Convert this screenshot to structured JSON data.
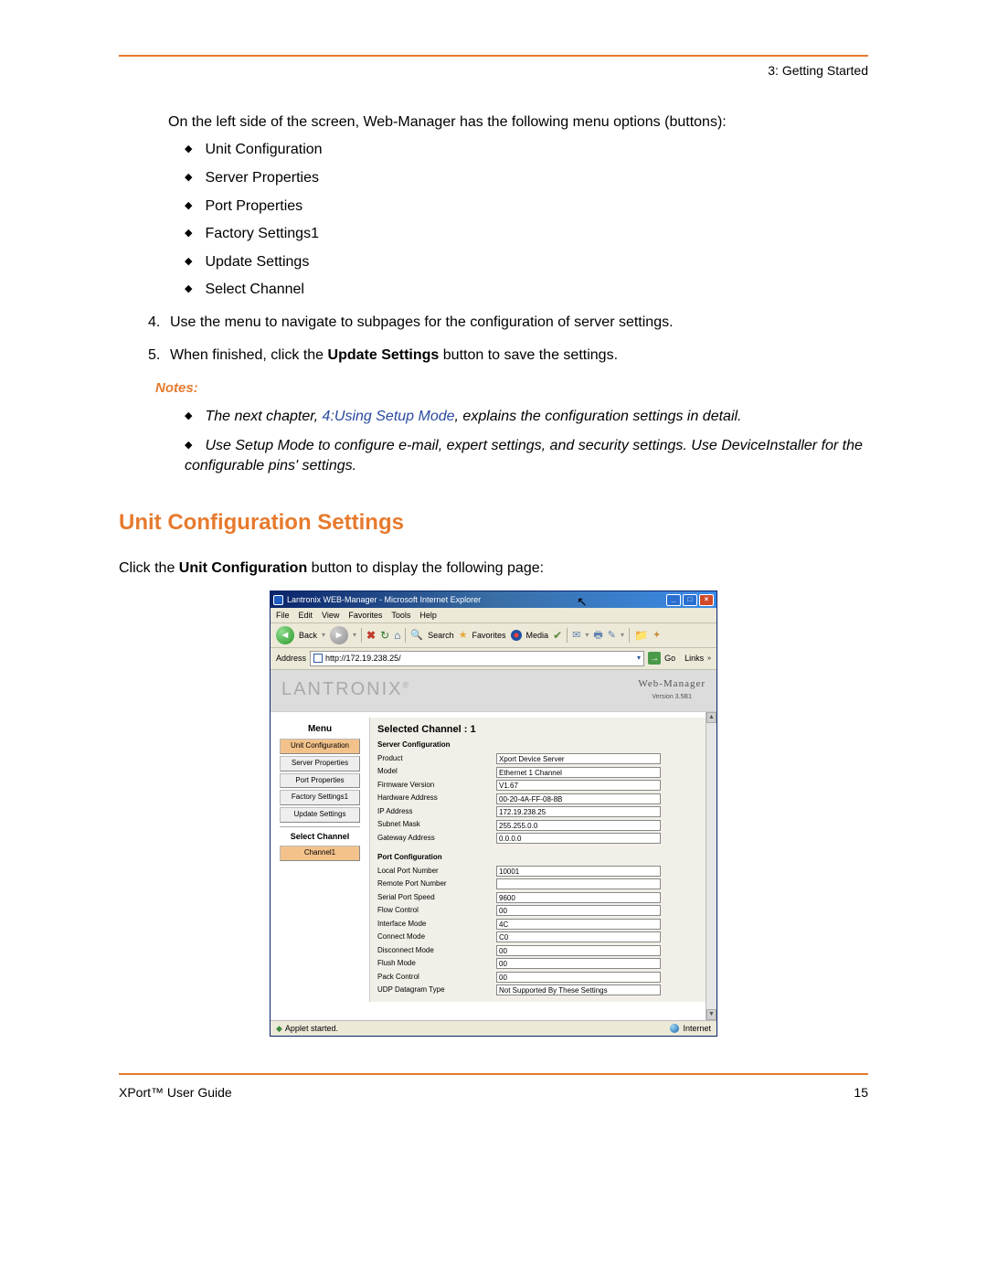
{
  "header": {
    "chapter": "3: Getting Started"
  },
  "body": {
    "intro": "On the left side of the screen, Web-Manager has the following menu options (buttons):",
    "menu_bullets": [
      "Unit Configuration",
      "Server Properties",
      "Port Properties",
      "Factory Settings1",
      "Update Settings",
      "Select Channel"
    ],
    "step4_num": "4.",
    "step4": "Use the menu to navigate to subpages for the configuration of server settings.",
    "step5_num": "5.",
    "step5_pre": "When finished, click the ",
    "step5_bold": "Update Settings",
    "step5_post": " button to save the settings.",
    "notes_label": "Notes:",
    "note1_pre": "The next chapter, ",
    "note1_link": "4:Using Setup Mode",
    "note1_post": ", explains the configuration settings in detail.",
    "note2": "Use Setup Mode to configure e-mail, expert settings, and security settings. Use DeviceInstaller for the configurable pins' settings.",
    "h2": "Unit Configuration Settings",
    "click_pre": "Click the ",
    "click_bold": "Unit Configuration",
    "click_post": " button to display the following page:"
  },
  "ie": {
    "title": "Lantronix WEB-Manager - Microsoft Internet Explorer",
    "menus": [
      "File",
      "Edit",
      "View",
      "Favorites",
      "Tools",
      "Help"
    ],
    "back_label": "Back",
    "search": "Search",
    "favorites": "Favorites",
    "media": "Media",
    "address_label": "Address",
    "address_url": "http://172.19.238.25/",
    "go_label": "Go",
    "links_label": "Links",
    "brand": "LANTRONIX",
    "brand_reg": "®",
    "wm_title": "Web-Manager",
    "wm_version": "Version 3.5B1",
    "menu_title": "Menu",
    "menu_items": [
      {
        "label": "Unit Configuration",
        "active": true
      },
      {
        "label": "Server Properties",
        "active": false
      },
      {
        "label": "Port Properties",
        "active": false
      },
      {
        "label": "Factory Settings1",
        "active": false
      },
      {
        "label": "Update Settings",
        "active": false
      }
    ],
    "select_channel": "Select Channel",
    "channel_btn": "Channel1",
    "selected_channel": "Selected Channel : 1",
    "server_config_title": "Server Configuration",
    "server_fields": [
      {
        "label": "Product",
        "value": "Xport Device Server"
      },
      {
        "label": "Model",
        "value": "Ethernet 1 Channel"
      },
      {
        "label": "Firmware Version",
        "value": "V1.67"
      },
      {
        "label": "Hardware Address",
        "value": "00-20-4A-FF-08-8B"
      },
      {
        "label": "IP Address",
        "value": "172.19.238.25"
      },
      {
        "label": "Subnet Mask",
        "value": "255.255.0.0"
      },
      {
        "label": "Gateway Address",
        "value": "0.0.0.0"
      }
    ],
    "port_config_title": "Port Configuration",
    "port_fields": [
      {
        "label": "Local Port Number",
        "value": "10001"
      },
      {
        "label": "Remote Port Number",
        "value": ""
      },
      {
        "label": "Serial Port Speed",
        "value": "9600"
      },
      {
        "label": "Flow Control",
        "value": "00"
      },
      {
        "label": "Interface Mode",
        "value": "4C"
      },
      {
        "label": "Connect Mode",
        "value": "C0"
      },
      {
        "label": "Disconnect Mode",
        "value": "00"
      },
      {
        "label": "Flush Mode",
        "value": "00"
      },
      {
        "label": "Pack Control",
        "value": "00"
      },
      {
        "label": "UDP Datagram Type",
        "value": "Not Supported By These Settings"
      }
    ],
    "status_left": "Applet started.",
    "status_right": "Internet"
  },
  "footer": {
    "left": "XPort™ User Guide",
    "right": "15"
  }
}
